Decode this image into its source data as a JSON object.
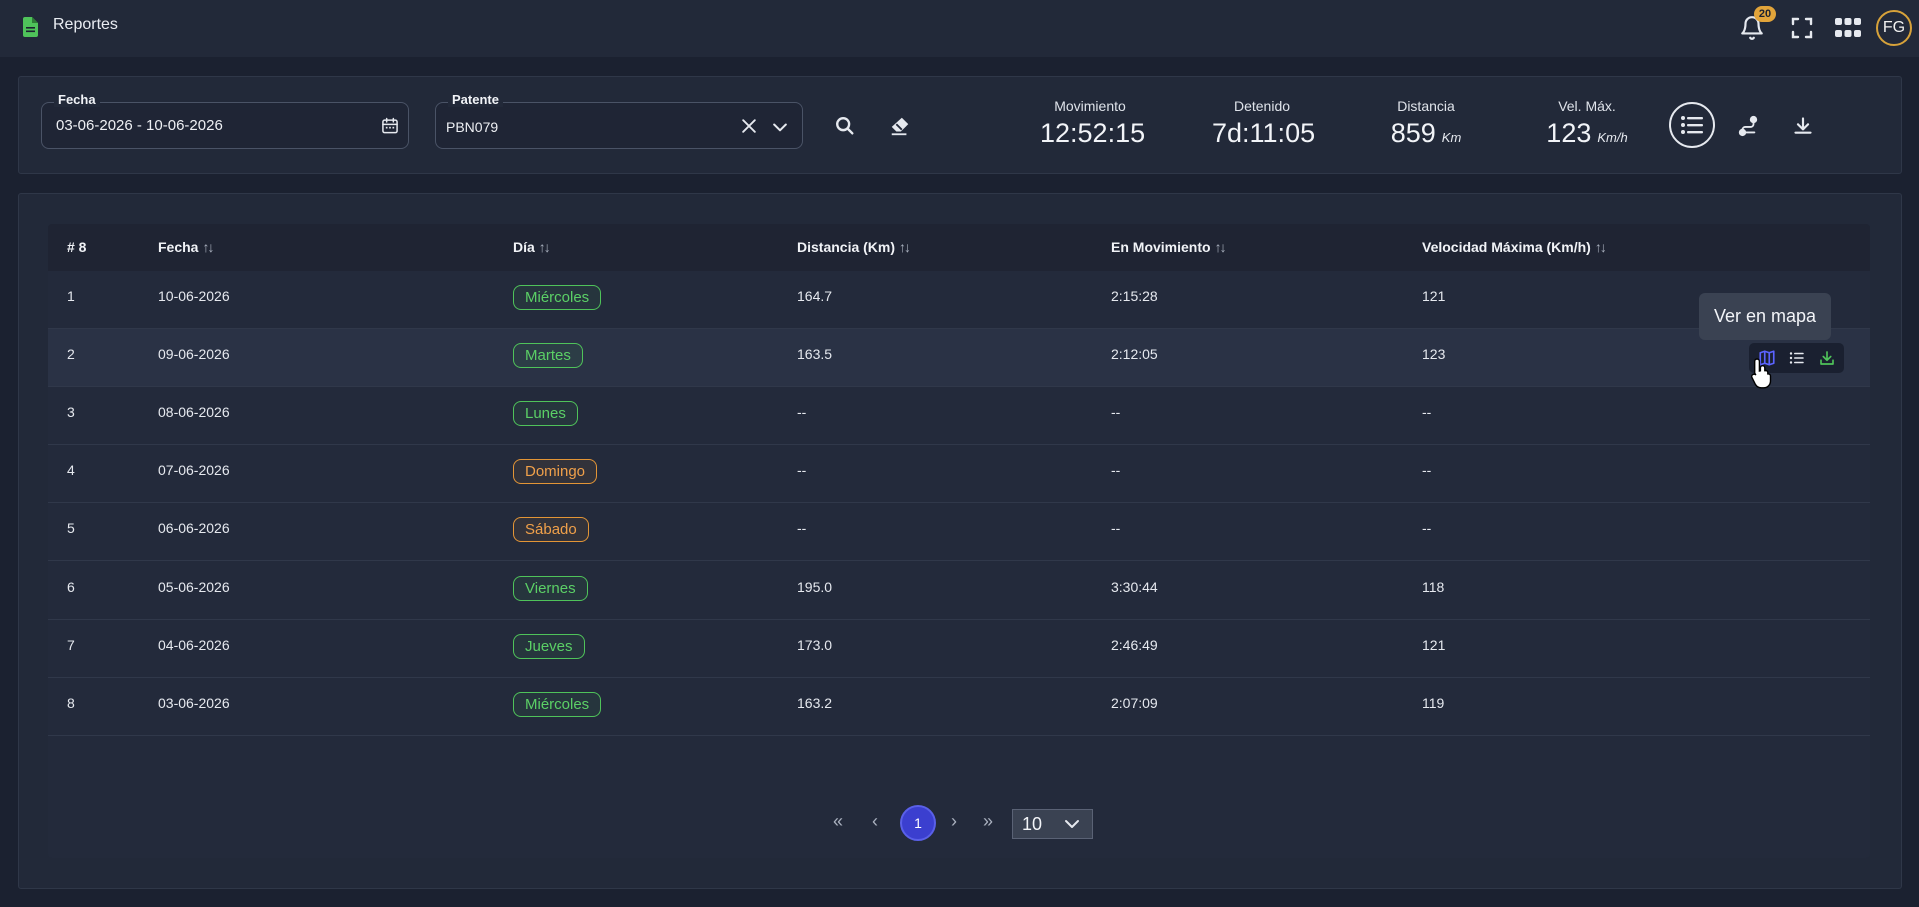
{
  "topbar": {
    "title": "Reportes",
    "notification_count": "20",
    "avatar_initials": "FG"
  },
  "filters": {
    "date": {
      "label": "Fecha",
      "value": "03-06-2026 - 10-06-2026"
    },
    "plate": {
      "label": "Patente",
      "value": "PBN079"
    }
  },
  "stats": [
    {
      "label": "Movimiento",
      "value": "12:52:15",
      "unit": ""
    },
    {
      "label": "Detenido",
      "value": "7d:11:05",
      "unit": ""
    },
    {
      "label": "Distancia",
      "value": "859",
      "unit": "Km"
    },
    {
      "label": "Vel. Máx.",
      "value": "123",
      "unit": "Km/h"
    }
  ],
  "table": {
    "headers": {
      "index": "# 8",
      "date": "Fecha",
      "day": "Día",
      "distance": "Distancia (Km)",
      "moving": "En Movimiento",
      "max_speed": "Velocidad Máxima (Km/h)"
    },
    "rows": [
      {
        "index": "1",
        "date": "10-06-2026",
        "day": "Miércoles",
        "day_color": "green",
        "distance": "164.7",
        "moving": "2:15:28",
        "max_speed": "121"
      },
      {
        "index": "2",
        "date": "09-06-2026",
        "day": "Martes",
        "day_color": "green",
        "distance": "163.5",
        "moving": "2:12:05",
        "max_speed": "123"
      },
      {
        "index": "3",
        "date": "08-06-2026",
        "day": "Lunes",
        "day_color": "green",
        "distance": "--",
        "moving": "--",
        "max_speed": "--"
      },
      {
        "index": "4",
        "date": "07-06-2026",
        "day": "Domingo",
        "day_color": "orange",
        "distance": "--",
        "moving": "--",
        "max_speed": "--"
      },
      {
        "index": "5",
        "date": "06-06-2026",
        "day": "Sábado",
        "day_color": "orange",
        "distance": "--",
        "moving": "--",
        "max_speed": "--"
      },
      {
        "index": "6",
        "date": "05-06-2026",
        "day": "Viernes",
        "day_color": "green",
        "distance": "195.0",
        "moving": "3:30:44",
        "max_speed": "118"
      },
      {
        "index": "7",
        "date": "04-06-2026",
        "day": "Jueves",
        "day_color": "green",
        "distance": "173.0",
        "moving": "2:46:49",
        "max_speed": "121"
      },
      {
        "index": "8",
        "date": "03-06-2026",
        "day": "Miércoles",
        "day_color": "green",
        "distance": "163.2",
        "moving": "2:07:09",
        "max_speed": "119"
      }
    ]
  },
  "tooltip": {
    "text": "Ver en mapa"
  },
  "pagination": {
    "current_page": "1",
    "page_size": "10"
  },
  "colors": {
    "accent": "#3b3fcf",
    "weekday": "#4fc35a",
    "weekend": "#e39536",
    "badge": "#e2a43a"
  }
}
